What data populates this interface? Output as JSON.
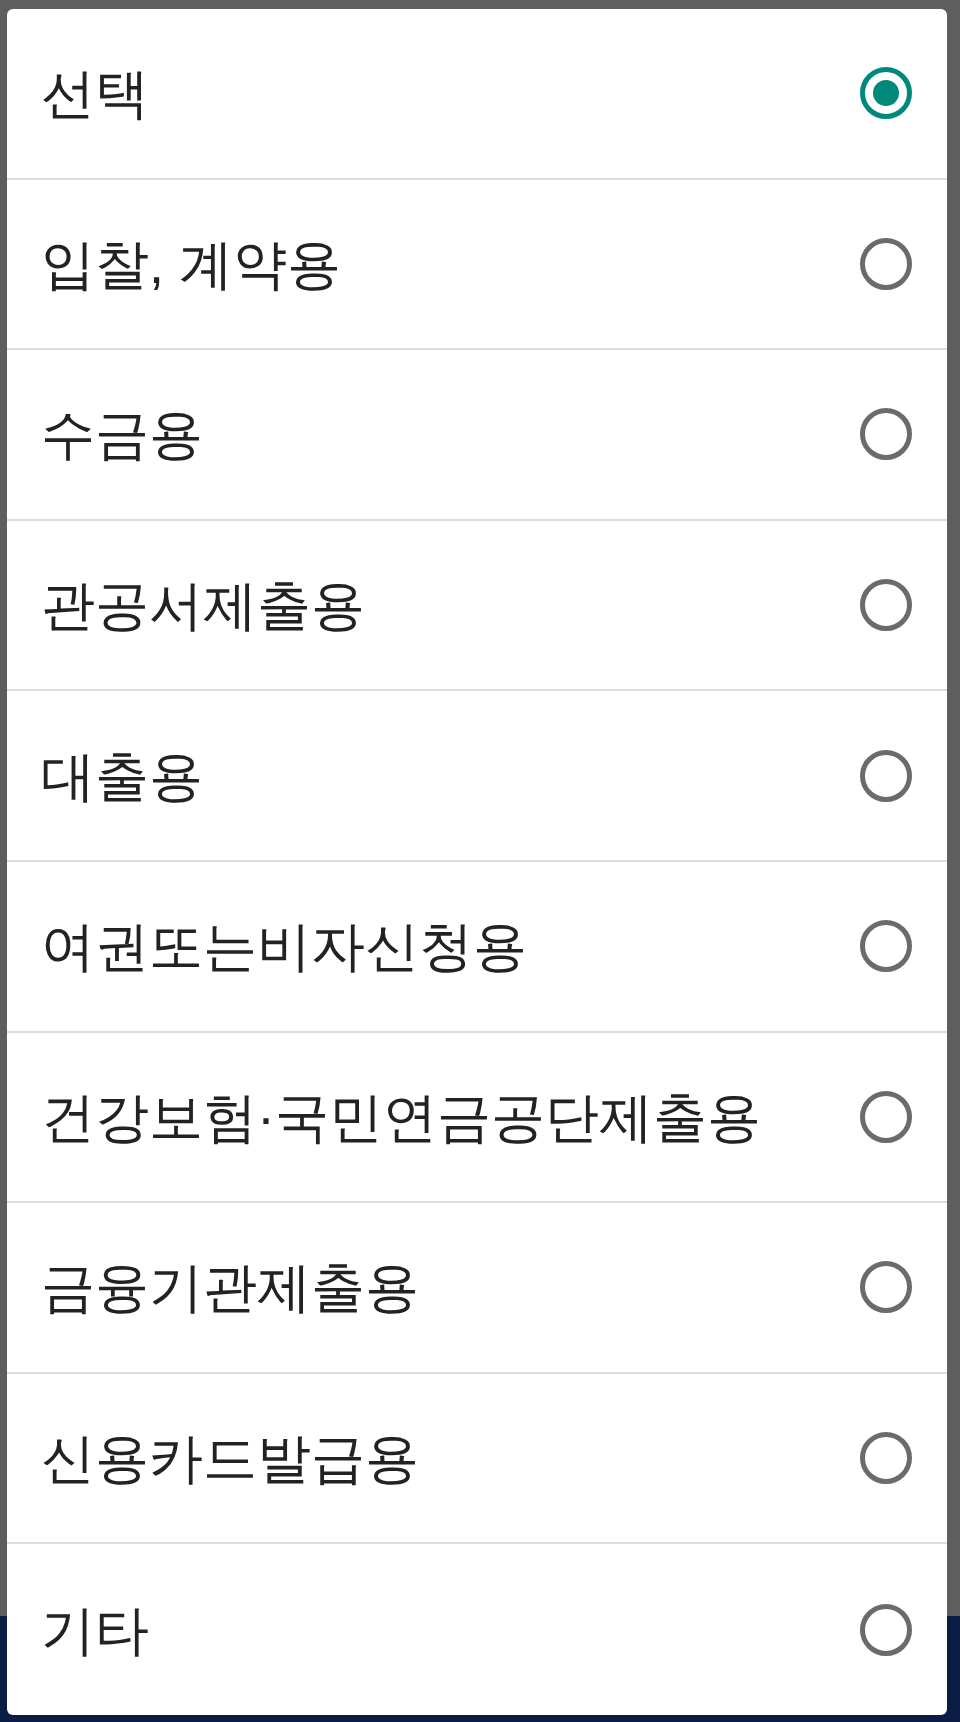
{
  "dialog": {
    "options": [
      {
        "label": "선택",
        "selected": true
      },
      {
        "label": "입찰, 계약용",
        "selected": false
      },
      {
        "label": "수금용",
        "selected": false
      },
      {
        "label": "관공서제출용",
        "selected": false
      },
      {
        "label": "대출용",
        "selected": false
      },
      {
        "label": "여권또는비자신청용",
        "selected": false
      },
      {
        "label": "건강보험·국민연금공단제출용",
        "selected": false
      },
      {
        "label": "금융기관제출용",
        "selected": false
      },
      {
        "label": "신용카드발급용",
        "selected": false
      },
      {
        "label": "기타",
        "selected": false
      }
    ]
  }
}
